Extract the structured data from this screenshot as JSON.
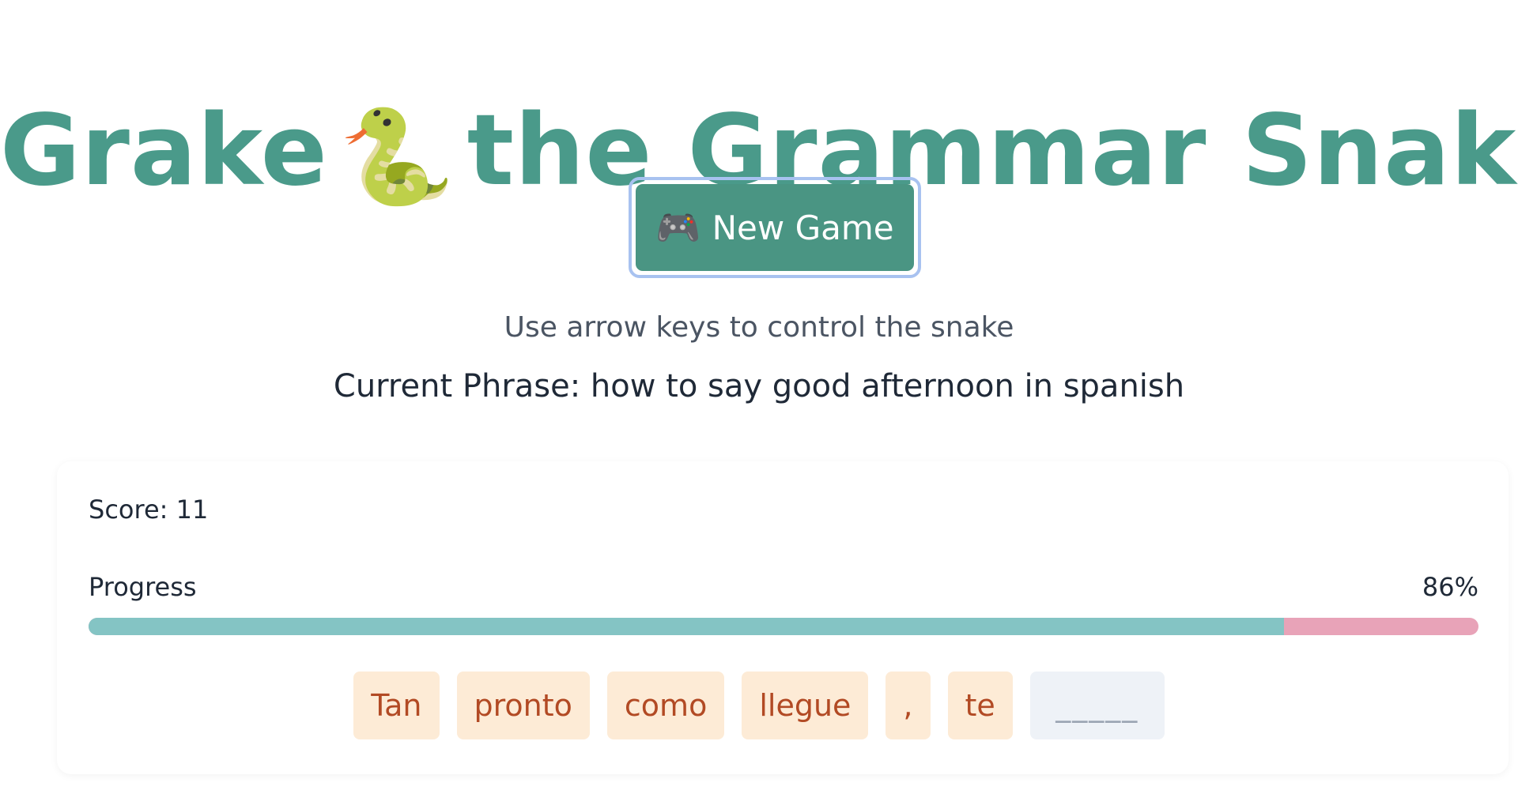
{
  "header": {
    "title_before": "Grake",
    "title_icon": "snake-icon",
    "title_after": "the Grammar Snake"
  },
  "controls": {
    "new_game_icon": "controller-icon",
    "new_game_label": "New Game",
    "instructions": "Use arrow keys to control the snake"
  },
  "phrase": {
    "label": "Current Phrase:",
    "value": "how to say good afternoon in spanish"
  },
  "stats": {
    "score_label": "Score:",
    "score_value": "11",
    "progress_label": "Progress",
    "progress_text": "86%",
    "progress_value": 0.86
  },
  "tokens": [
    {
      "text": "Tan",
      "type": "word"
    },
    {
      "text": "pronto",
      "type": "word"
    },
    {
      "text": "como",
      "type": "word"
    },
    {
      "text": "llegue",
      "type": "word"
    },
    {
      "text": ",",
      "type": "word"
    },
    {
      "text": "te",
      "type": "word"
    },
    {
      "text": "_____",
      "type": "blank"
    }
  ],
  "colors": {
    "accent": "#4a9a8a",
    "button": "#4a9583",
    "progress_fill": "#84c4c4",
    "progress_track": "#e8a3b8",
    "token_bg": "#fdebd6",
    "token_text": "#b24a24"
  }
}
